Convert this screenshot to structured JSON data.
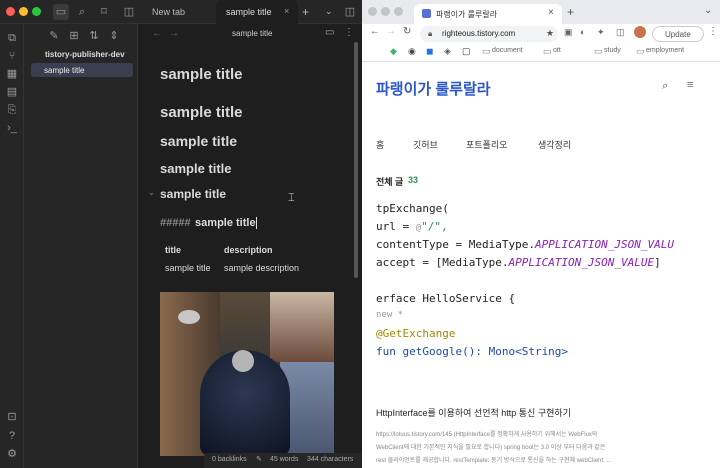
{
  "obsidian": {
    "tabs": [
      "New tab",
      "sample title"
    ],
    "tab_plus": "+",
    "vault": "tistory-publisher-dev",
    "file": "sample title",
    "note_title": "sample title",
    "headings": [
      "sample title",
      "sample title",
      "sample title",
      "sample title",
      "sample title"
    ],
    "heading_raw_prefix": "#####",
    "heading_raw_text": "sample title",
    "table": {
      "headers": [
        "title",
        "description"
      ],
      "row": [
        "sample title",
        "sample description"
      ]
    },
    "status": {
      "backlinks": "0 backlinks",
      "words": "45 words",
      "chars": "344 characters"
    }
  },
  "browser": {
    "tab_title": "파랭이가 룰루랄라",
    "url": "righteous.tistory.com",
    "update": "Update",
    "bookmarks": [
      "document",
      "ott",
      "study",
      "employment"
    ],
    "blog_title": "파랭이가 룰루랄라",
    "nav": [
      "홈",
      "깃허브",
      "포트폴리오",
      "생각정리"
    ],
    "count_label": "전체 글",
    "count": "33",
    "code": [
      {
        "plain": "tpExchange(",
        "kw": "",
        "rest": ""
      },
      {
        "plain": " url = ",
        "kw": "@",
        "rest": "\"/\","
      },
      {
        "plain": " contentType = MediaType.",
        "kw": "APPLICATION_JSON_VALU",
        "rest": ""
      },
      {
        "plain": " accept = [MediaType.",
        "kw": "APPLICATION_JSON_VALUE",
        "rest": "]"
      },
      {
        "plain": "",
        "kw": "",
        "rest": ""
      },
      {
        "plain": "erface HelloService {",
        "kw": "",
        "rest": ""
      },
      {
        "plain": " new *",
        "kw": "",
        "rest": ""
      },
      {
        "plain": " @GetExchange",
        "kw": "",
        "rest": ""
      },
      {
        "plain": " fun getGoogle(): Mono<String>",
        "kw": "",
        "rest": ""
      }
    ],
    "post_title": "HttpInterface를 이용하여 선언적 http 통신 구현하기",
    "post_excerpt_1": "https://lotuus.tistory.com/145 (HttpInterface를 정확하게 사용하기 위해서는 WebFlux와",
    "post_excerpt_2": "WebClient에 대한 기본적인 지식을 필요로 합니다) spring boot는 3.0 이상 부터 다음과 같은",
    "post_excerpt_3": "rest 클라이언트를 제공합니다. restTemplate: 동기 방식으로 통신을 하는 구현체 webClient: ..."
  },
  "colors": {
    "accent": "#2b57c7",
    "count": "#2e8b57",
    "code_const": "#8b1fb5"
  }
}
